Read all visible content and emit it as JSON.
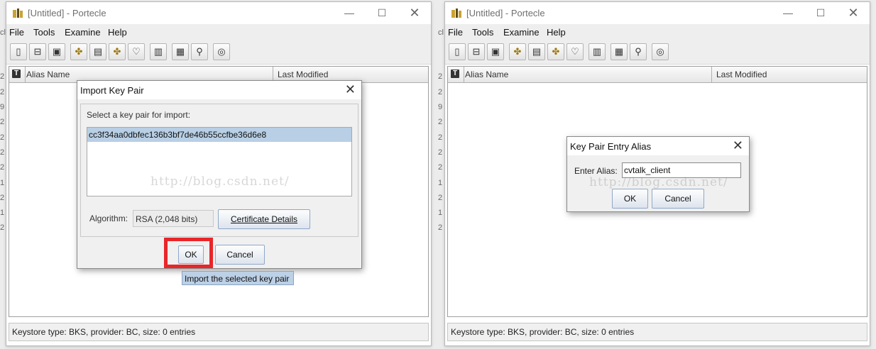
{
  "window": {
    "title": "[Untitled] - Portecle",
    "minimize": "—",
    "maximize": "☐",
    "close": "✕"
  },
  "menu": [
    "File",
    "Tools",
    "Examine",
    "Help"
  ],
  "toolbar_icons": [
    "new-keystore-icon",
    "open-keystore-icon",
    "save-keystore-icon",
    "generate-key-pair-icon",
    "import-certificate-icon",
    "import-key-pair-icon",
    "set-keystore-password-icon",
    "examine-certificate-icon",
    "examine-csr-icon",
    "examine-crl-icon",
    "help-icon"
  ],
  "table": {
    "col_alias": "Alias Name",
    "col_modified": "Last Modified"
  },
  "status": "Keystore type: BKS, provider: BC, size: 0 entries",
  "watermark": "http://blog.csdn.net/",
  "edge_left": [
    "cl",
    "2",
    "2",
    "9",
    "2",
    "2",
    "2",
    "2",
    "1",
    "2",
    "1",
    "2"
  ],
  "import_dialog": {
    "title": "Import Key Pair",
    "prompt": "Select a key pair for import:",
    "selected_key": "cc3f34aa0dbfec136b3bf7de46b55ccfbe36d6e8",
    "algorithm_label": "Algorithm:",
    "algorithm_value": "RSA (2,048 bits)",
    "details_button": "Certificate Details",
    "ok_button": "OK",
    "cancel_button": "Cancel",
    "tooltip": "Import the selected key pair",
    "highlight_color": "#e8262a"
  },
  "alias_dialog": {
    "title": "Key Pair Entry Alias",
    "label": "Enter Alias:",
    "value": "cvtalk_client",
    "ok_button": "OK",
    "cancel_button": "Cancel"
  }
}
